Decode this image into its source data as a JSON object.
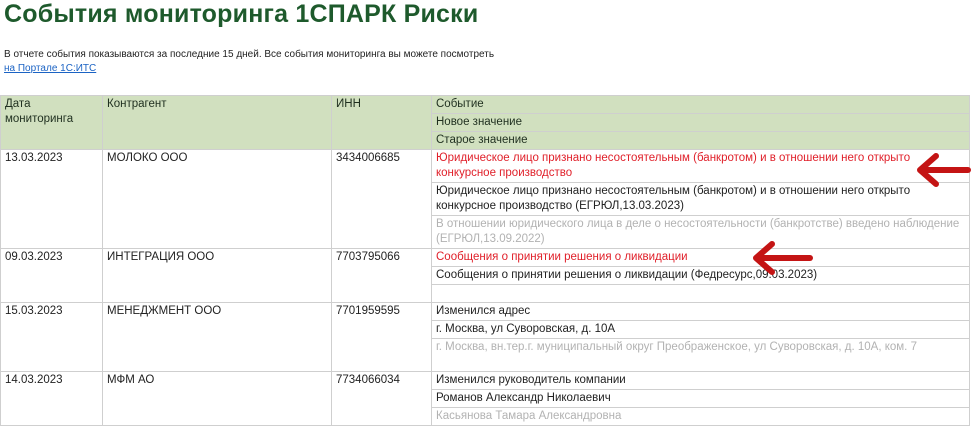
{
  "title": "События мониторинга 1СПАРК Риски",
  "intro": {
    "text": "В отчете события показываются за последние 15 дней. Все события мониторинга вы можете посмотреть",
    "link_label": "на Портале 1С:ИТС"
  },
  "table": {
    "headers": {
      "date": "Дата мониторинга",
      "counterparty": "Контрагент",
      "inn": "ИНН",
      "event": "Событие",
      "new_value": "Новое значение",
      "old_value": "Старое значение"
    },
    "rows": [
      {
        "date": "13.03.2023",
        "counterparty": "МОЛОКО ООО",
        "inn": "3434006685",
        "event": "Юридическое лицо признано несостоятельным (банкротом) и в отношении него открыто конкурсное производство",
        "new_value": "Юридическое лицо признано несостоятельным (банкротом) и в отношении него открыто конкурсное производство (ЕГРЮЛ,13.03.2023)",
        "old_value": "В отношении юридического лица в деле о несостоятельности (банкротстве) введено наблюдение (ЕГРЮЛ,13.09.2022)"
      },
      {
        "date": "09.03.2023",
        "counterparty": "ИНТЕГРАЦИЯ ООО",
        "inn": "7703795066",
        "event": "Сообщения о принятии решения о ликвидации",
        "new_value": "Сообщения о принятии решения о ликвидации (Федресурс,09.03.2023)",
        "old_value": ""
      },
      {
        "date": "15.03.2023",
        "counterparty": "МЕНЕДЖМЕНТ ООО",
        "inn": "7701959595",
        "event": "Изменился адрес",
        "new_value": "г. Москва, ул Суворовская, д. 10А",
        "old_value": "г. Москва, вн.тер.г. муниципальный округ Преображенское, ул Суворовская, д. 10А, ком. 7"
      },
      {
        "date": "14.03.2023",
        "counterparty": "МФМ АО",
        "inn": "7734066034",
        "event": "Изменился руководитель компании",
        "new_value": "Романов Александр Николаевич",
        "old_value": "Касьянова Тамара Александровна"
      }
    ]
  },
  "colors": {
    "title": "#1e5a2c",
    "header_bg": "#d1e0bf",
    "event_text": "#e0202a",
    "old_value_text": "#b2b2b2",
    "arrow": "#c41414",
    "link": "#1b63c4"
  },
  "icons": [
    "left-arrow-icon",
    "left-arrow-icon"
  ]
}
